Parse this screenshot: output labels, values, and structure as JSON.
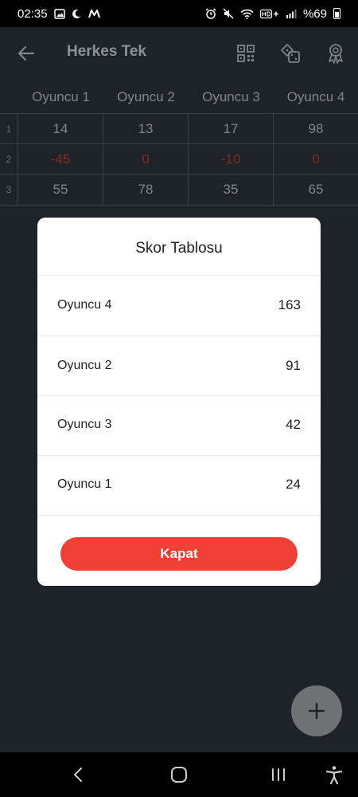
{
  "status_bar": {
    "time": "02:35",
    "battery_text": "%69",
    "left_icons": [
      "image-icon",
      "moon-icon",
      "m-app-icon"
    ],
    "right_icons": [
      "alarm-icon",
      "mute-icon",
      "wifi-icon",
      "hd-signal-icon",
      "signal-icon",
      "battery-icon"
    ]
  },
  "toolbar": {
    "title": "Herkes Tek",
    "icons": [
      "qr-code-icon",
      "dice-icon",
      "award-icon"
    ]
  },
  "table": {
    "headers": [
      "Oyuncu 1",
      "Oyuncu 2",
      "Oyuncu 3",
      "Oyuncu 4"
    ],
    "rows": [
      {
        "index": "1",
        "values": [
          "14",
          "13",
          "17",
          "98"
        ]
      },
      {
        "index": "2",
        "values": [
          "-45",
          "0",
          "-10",
          "0"
        ]
      },
      {
        "index": "3",
        "values": [
          "55",
          "78",
          "35",
          "65"
        ]
      }
    ]
  },
  "dialog": {
    "title": "Skor Tablosu",
    "scores": [
      {
        "name": "Oyuncu 4",
        "score": "163"
      },
      {
        "name": "Oyuncu 2",
        "score": "91"
      },
      {
        "name": "Oyuncu 3",
        "score": "42"
      },
      {
        "name": "Oyuncu 1",
        "score": "24"
      }
    ],
    "close_label": "Kapat"
  },
  "colors": {
    "accent": "#f04035",
    "background": "#1d2328",
    "negative_value": "#8a2a25"
  }
}
